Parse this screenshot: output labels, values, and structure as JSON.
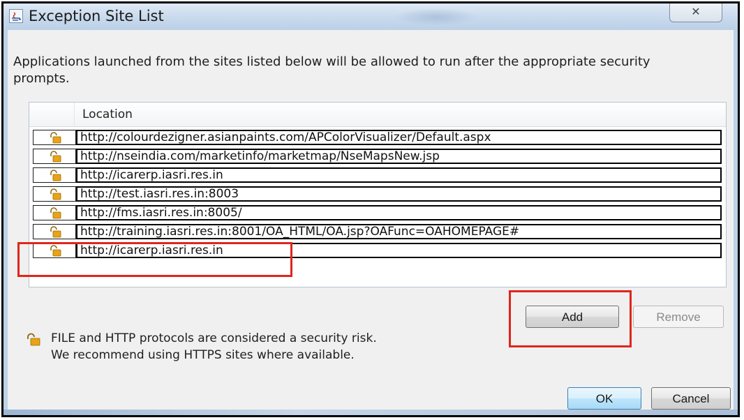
{
  "window": {
    "title": "Exception Site List",
    "close_label": "✕"
  },
  "description": "Applications launched from the sites listed below will be allowed to run after the appropriate security prompts.",
  "table": {
    "column_header": "Location",
    "rows": [
      {
        "url": "http://colourdezigner.asianpaints.com/APColorVisualizer/Default.aspx",
        "icon": "unlocked-padlock-icon"
      },
      {
        "url": "http://nseindia.com/marketinfo/marketmap/NseMapsNew.jsp",
        "icon": "unlocked-padlock-icon"
      },
      {
        "url": "http://icarerp.iasri.res.in",
        "icon": "unlocked-padlock-icon"
      },
      {
        "url": "http://test.iasri.res.in:8003",
        "icon": "unlocked-padlock-icon"
      },
      {
        "url": "http://fms.iasri.res.in:8005/",
        "icon": "unlocked-padlock-icon"
      },
      {
        "url": "http://training.iasri.res.in:8001/OA_HTML/OA.jsp?OAFunc=OAHOMEPAGE#",
        "icon": "unlocked-padlock-icon"
      },
      {
        "url": "http://icarerp.iasri.res.in",
        "icon": "unlocked-padlock-icon"
      }
    ]
  },
  "buttons": {
    "add": "Add",
    "remove": "Remove",
    "ok": "OK",
    "cancel": "Cancel"
  },
  "warning": {
    "line1": "FILE and HTTP protocols are considered a security risk.",
    "line2": "We recommend using HTTPS sites where available.",
    "icon": "unlocked-padlock-icon"
  },
  "colors": {
    "highlight": "#e0261b",
    "padlock": "#e8a317"
  }
}
